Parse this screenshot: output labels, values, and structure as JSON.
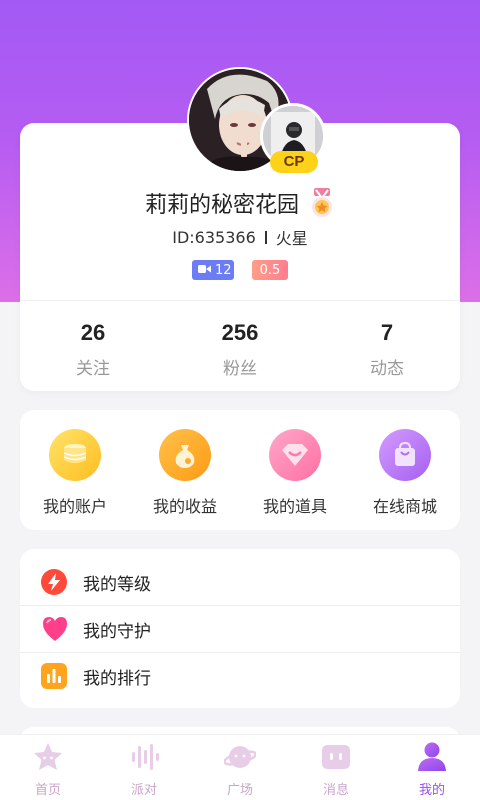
{
  "profile": {
    "nickname": "莉莉的秘密花园",
    "id_text": "ID:635366",
    "location": "火星",
    "cp_badge": "CP",
    "video_count": "12",
    "level": "0.5"
  },
  "stats": [
    {
      "value": "26",
      "label": "关注"
    },
    {
      "value": "256",
      "label": "粉丝"
    },
    {
      "value": "7",
      "label": "动态"
    }
  ],
  "wallet": [
    {
      "label": "我的账户",
      "icon": "coins-icon"
    },
    {
      "label": "我的收益",
      "icon": "money-bag-icon"
    },
    {
      "label": "我的道具",
      "icon": "gem-icon"
    },
    {
      "label": "在线商城",
      "icon": "shopping-bag-icon"
    }
  ],
  "menu": [
    {
      "label": "我的等级",
      "icon": "lightning-icon"
    },
    {
      "label": "我的守护",
      "icon": "heart-icon"
    },
    {
      "label": "我的排行",
      "icon": "bar-chart-icon"
    }
  ],
  "tabs": [
    {
      "label": "首页",
      "icon": "star-icon",
      "active": false
    },
    {
      "label": "派对",
      "icon": "soundwave-icon",
      "active": false
    },
    {
      "label": "广场",
      "icon": "planet-icon",
      "active": false
    },
    {
      "label": "消息",
      "icon": "message-icon",
      "active": false
    },
    {
      "label": "我的",
      "icon": "user-icon",
      "active": true
    }
  ],
  "colors": {
    "header_gradient_top": "#a35af5",
    "header_gradient_bottom": "#dc6fe8",
    "accent": "#9a4ff0",
    "tab_inactive": "#c9a6c9",
    "cp_badge": "#ffd21a"
  }
}
